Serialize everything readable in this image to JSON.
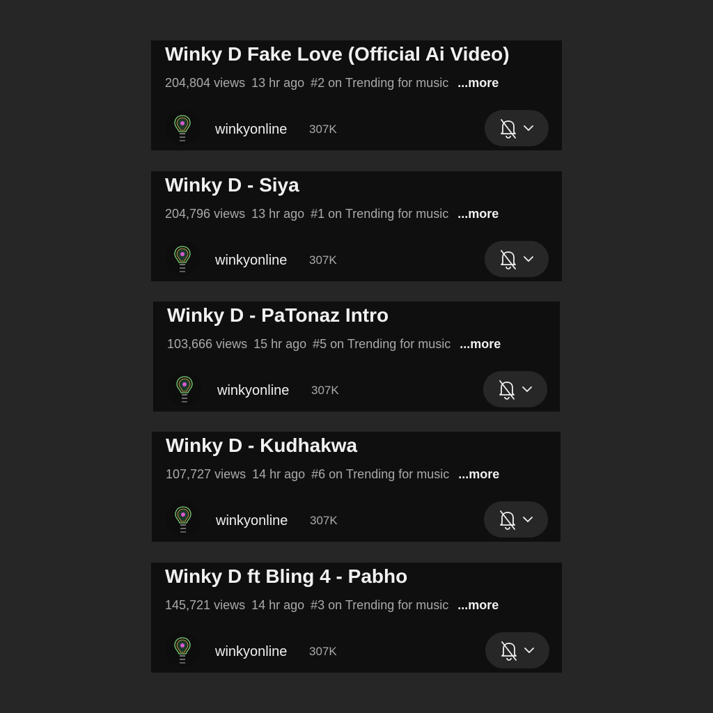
{
  "colors": {
    "page_background": "#262626",
    "card_background": "#0f0f0f",
    "primary_text": "#f1f1f1",
    "secondary_text": "#aaaaaa",
    "button_background": "#272727"
  },
  "videos": [
    {
      "title": "Winky D Fake Love (Official Ai Video)",
      "views": "204,804 views",
      "age": "13 hr ago",
      "trending": "#2 on Trending for music",
      "more_label": "...more",
      "channel": "winkyonline",
      "subscribers": "307K",
      "notification_icon": "bell-off-icon",
      "dropdown_icon": "chevron-down-icon"
    },
    {
      "title": "Winky D - Siya",
      "views": "204,796 views",
      "age": "13 hr ago",
      "trending": "#1 on Trending for music",
      "more_label": "...more",
      "channel": "winkyonline",
      "subscribers": "307K",
      "notification_icon": "bell-off-icon",
      "dropdown_icon": "chevron-down-icon"
    },
    {
      "title": "Winky D - PaTonaz Intro",
      "views": "103,666 views",
      "age": "15 hr ago",
      "trending": "#5 on Trending for music",
      "more_label": "...more",
      "channel": "winkyonline",
      "subscribers": "307K",
      "notification_icon": "bell-off-icon",
      "dropdown_icon": "chevron-down-icon"
    },
    {
      "title": "Winky D - Kudhakwa",
      "views": "107,727 views",
      "age": "14 hr ago",
      "trending": "#6 on Trending for music",
      "more_label": "...more",
      "channel": "winkyonline",
      "subscribers": "307K",
      "notification_icon": "bell-off-icon",
      "dropdown_icon": "chevron-down-icon"
    },
    {
      "title": "Winky D ft Bling 4 - Pabho",
      "views": "145,721 views",
      "age": "14 hr ago",
      "trending": "#3 on Trending for music",
      "more_label": "...more",
      "channel": "winkyonline",
      "subscribers": "307K",
      "notification_icon": "bell-off-icon",
      "dropdown_icon": "chevron-down-icon"
    }
  ]
}
